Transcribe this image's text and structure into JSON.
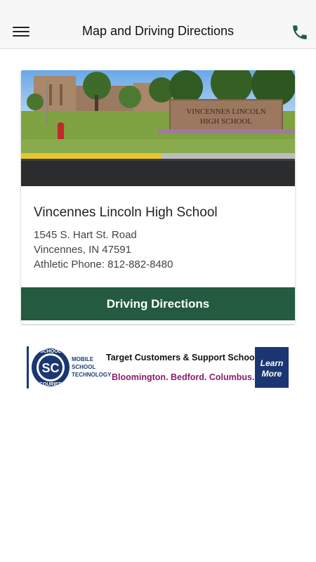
{
  "header": {
    "title": "Map and Driving Directions",
    "menu_icon": "hamburger-menu-icon",
    "phone_icon": "phone-icon",
    "phone_color": "#1f5e3e"
  },
  "location": {
    "photo_sign_line1": "VINCENNES LINCOLN",
    "photo_sign_line2": "HIGH SCHOOL",
    "name": "Vincennes Lincoln High School",
    "address_line1": "1545 S. Hart St. Road",
    "address_line2": "Vincennes, IN 47591",
    "phone_line": "Athletic Phone: 812-882-8480",
    "directions_label": "Driving Directions",
    "button_color": "#235a40"
  },
  "ad": {
    "logo_top": "SCHOOL",
    "logo_initials": "SC",
    "logo_bottom": "COURIER",
    "tagline_line1": "MOBILE",
    "tagline_line2": "SCHOOL",
    "tagline_line3": "TECHNOLOGY",
    "headline": "Target Customers & Support Schools",
    "cities": "Bloomington.  Bedford.  Columbus.",
    "cta_line1": "Learn",
    "cta_line2": "More",
    "brand_color": "#1b3672",
    "accent_color": "#8b1e6b"
  }
}
